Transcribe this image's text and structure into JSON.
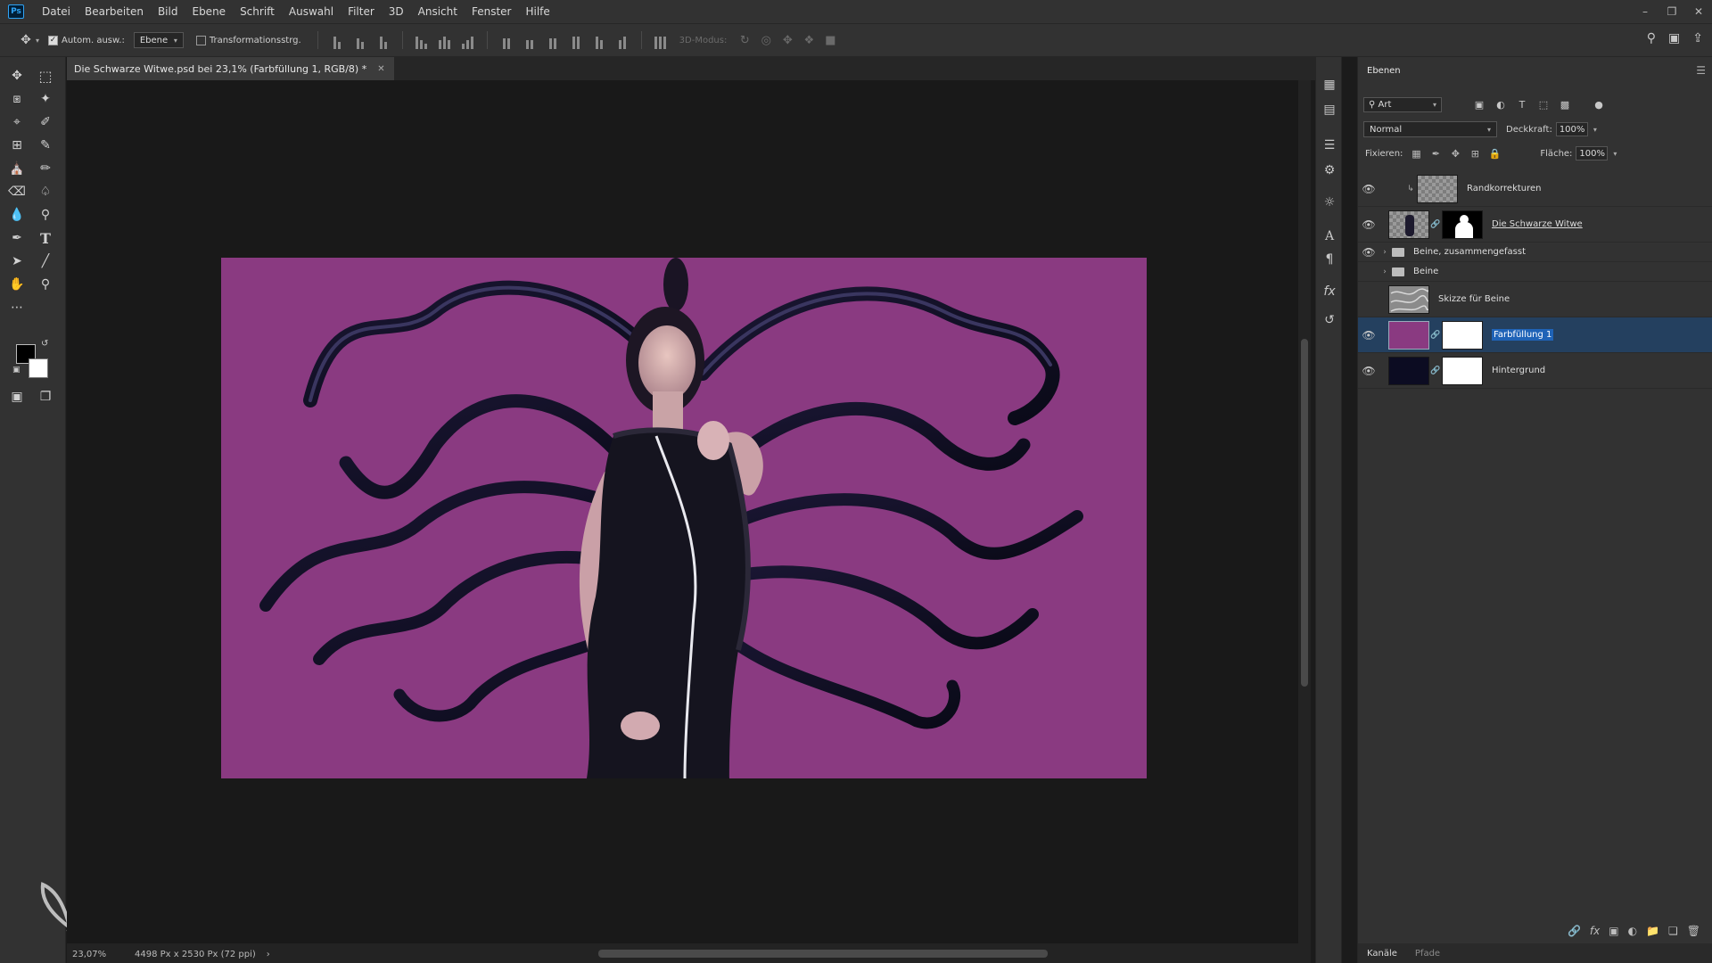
{
  "menubar": {
    "items": [
      "Datei",
      "Bearbeiten",
      "Bild",
      "Ebene",
      "Schrift",
      "Auswahl",
      "Filter",
      "3D",
      "Ansicht",
      "Fenster",
      "Hilfe"
    ],
    "app_badge": "Ps"
  },
  "options": {
    "auto_select_label": "Autom. ausw.:",
    "auto_select_checked": true,
    "auto_select_target": "Ebene",
    "transform_label": "Transformationsstrg.",
    "transform_checked": false,
    "mode_3d_label": "3D-Modus:"
  },
  "document": {
    "tab_title": "Die Schwarze Witwe.psd bei 23,1% (Farbfüllung 1, RGB/8) *",
    "canvas_color": "#8a3a81"
  },
  "status": {
    "zoom": "23,07%",
    "dimensions": "4498 Px x 2530 Px (72 ppi)"
  },
  "colors": {
    "foreground": "#000000",
    "background": "#ffffff",
    "selection": "#24405f"
  },
  "layers_panel": {
    "tab": "Ebenen",
    "filter_kind": "Art",
    "blend_mode": "Normal",
    "opacity_label": "Deckkraft:",
    "opacity": "100%",
    "lock_label": "Fixieren:",
    "fill_label": "Fläche:",
    "fill": "100%",
    "layers": [
      {
        "name": "Randkorrekturen",
        "visible": true
      },
      {
        "name": "Die Schwarze Witwe",
        "visible": true
      },
      {
        "name": "Beine, zusammengefasst",
        "visible": true
      },
      {
        "name": "Beine",
        "visible": false
      },
      {
        "name": "Skizze für Beine",
        "visible": false
      },
      {
        "name": "Farbfüllung 1",
        "visible": true,
        "selected": true
      },
      {
        "name": "Hintergrund",
        "visible": true
      }
    ],
    "bottom_tabs": [
      "Kanäle",
      "Pfade"
    ]
  }
}
